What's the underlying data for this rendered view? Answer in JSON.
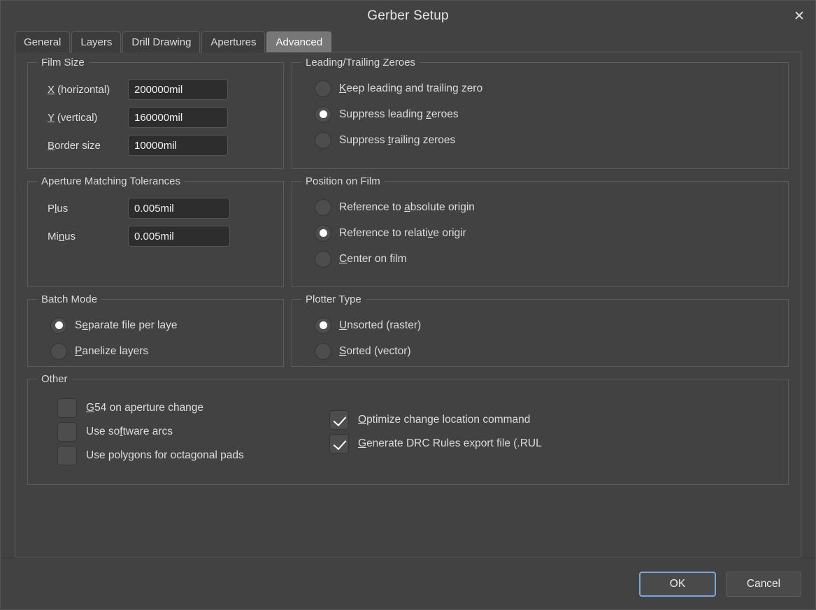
{
  "window": {
    "title": "Gerber Setup",
    "close_icon": "close-icon",
    "close_glyph": "✕"
  },
  "tabs": [
    {
      "label": "General",
      "active": false
    },
    {
      "label": "Layers",
      "active": false
    },
    {
      "label": "Drill Drawing",
      "active": false
    },
    {
      "label": "Apertures",
      "active": false
    },
    {
      "label": "Advanced",
      "active": true
    }
  ],
  "groups": {
    "film_size": {
      "legend": "Film Size",
      "fields": [
        {
          "label_pre": "",
          "label_acc": "X",
          "label_post": " (horizontal)",
          "value": "200000mil"
        },
        {
          "label_pre": "",
          "label_acc": "Y",
          "label_post": " (vertical)",
          "value": "160000mil"
        },
        {
          "label_pre": "",
          "label_acc": "B",
          "label_post": "order size",
          "value": "10000mil"
        }
      ]
    },
    "zeroes": {
      "legend": "Leading/Trailing Zeroes",
      "options": [
        {
          "pre": "",
          "acc": "K",
          "post": "eep leading and trailing zero",
          "selected": false
        },
        {
          "pre": "Suppress leading ",
          "acc": "z",
          "post": "eroes",
          "selected": true
        },
        {
          "pre": "Suppress ",
          "acc": "t",
          "post": "railing zeroes",
          "selected": false
        }
      ]
    },
    "tolerances": {
      "legend": "Aperture Matching Tolerances",
      "fields": [
        {
          "label_pre": "P",
          "label_acc": "l",
          "label_post": "us",
          "value": "0.005mil"
        },
        {
          "label_pre": "Mi",
          "label_acc": "n",
          "label_post": "us",
          "value": "0.005mil"
        }
      ]
    },
    "position": {
      "legend": "Position on Film",
      "options": [
        {
          "pre": "Reference to ",
          "acc": "a",
          "post": "bsolute origin",
          "selected": false
        },
        {
          "pre": "Reference to relati",
          "acc": "v",
          "post": "e origir",
          "selected": true
        },
        {
          "pre": "",
          "acc": "C",
          "post": "enter on film",
          "selected": false
        }
      ]
    },
    "batch_mode": {
      "legend": "Batch Mode",
      "options": [
        {
          "pre": "S",
          "acc": "e",
          "post": "parate file per laye",
          "selected": true
        },
        {
          "pre": "",
          "acc": "P",
          "post": "anelize layers",
          "selected": false
        }
      ]
    },
    "plotter_type": {
      "legend": "Plotter Type",
      "options": [
        {
          "pre": "",
          "acc": "U",
          "post": "nsorted (raster)",
          "selected": true
        },
        {
          "pre": "",
          "acc": "S",
          "post": "orted (vector)",
          "selected": false
        }
      ]
    },
    "other": {
      "legend": "Other",
      "left": [
        {
          "pre": "",
          "acc": "G",
          "post": "54 on aperture change",
          "checked": false
        },
        {
          "pre": "Use so",
          "acc": "f",
          "post": "tware arcs",
          "checked": false
        },
        {
          "pre": "Use polygons for octagonal pads",
          "acc": "",
          "post": "",
          "checked": false
        }
      ],
      "right": [
        {
          "pre": "",
          "acc": "O",
          "post": "ptimize change location command",
          "checked": true
        },
        {
          "pre": "",
          "acc": "G",
          "post": "enerate DRC Rules export file (.RUL",
          "checked": true
        }
      ]
    }
  },
  "footer": {
    "ok_label": "OK",
    "cancel_label": "Cancel"
  },
  "colors": {
    "dialog_bg": "#424242",
    "panel_border": "#5a5a5a",
    "group_border": "#5c5c5c",
    "text": "#dcdcdc",
    "input_bg": "#2d2d2d",
    "control_bg": "#4d4d4d",
    "active_tab_bg": "#777777",
    "focus_accent": "#7aa8dd"
  }
}
